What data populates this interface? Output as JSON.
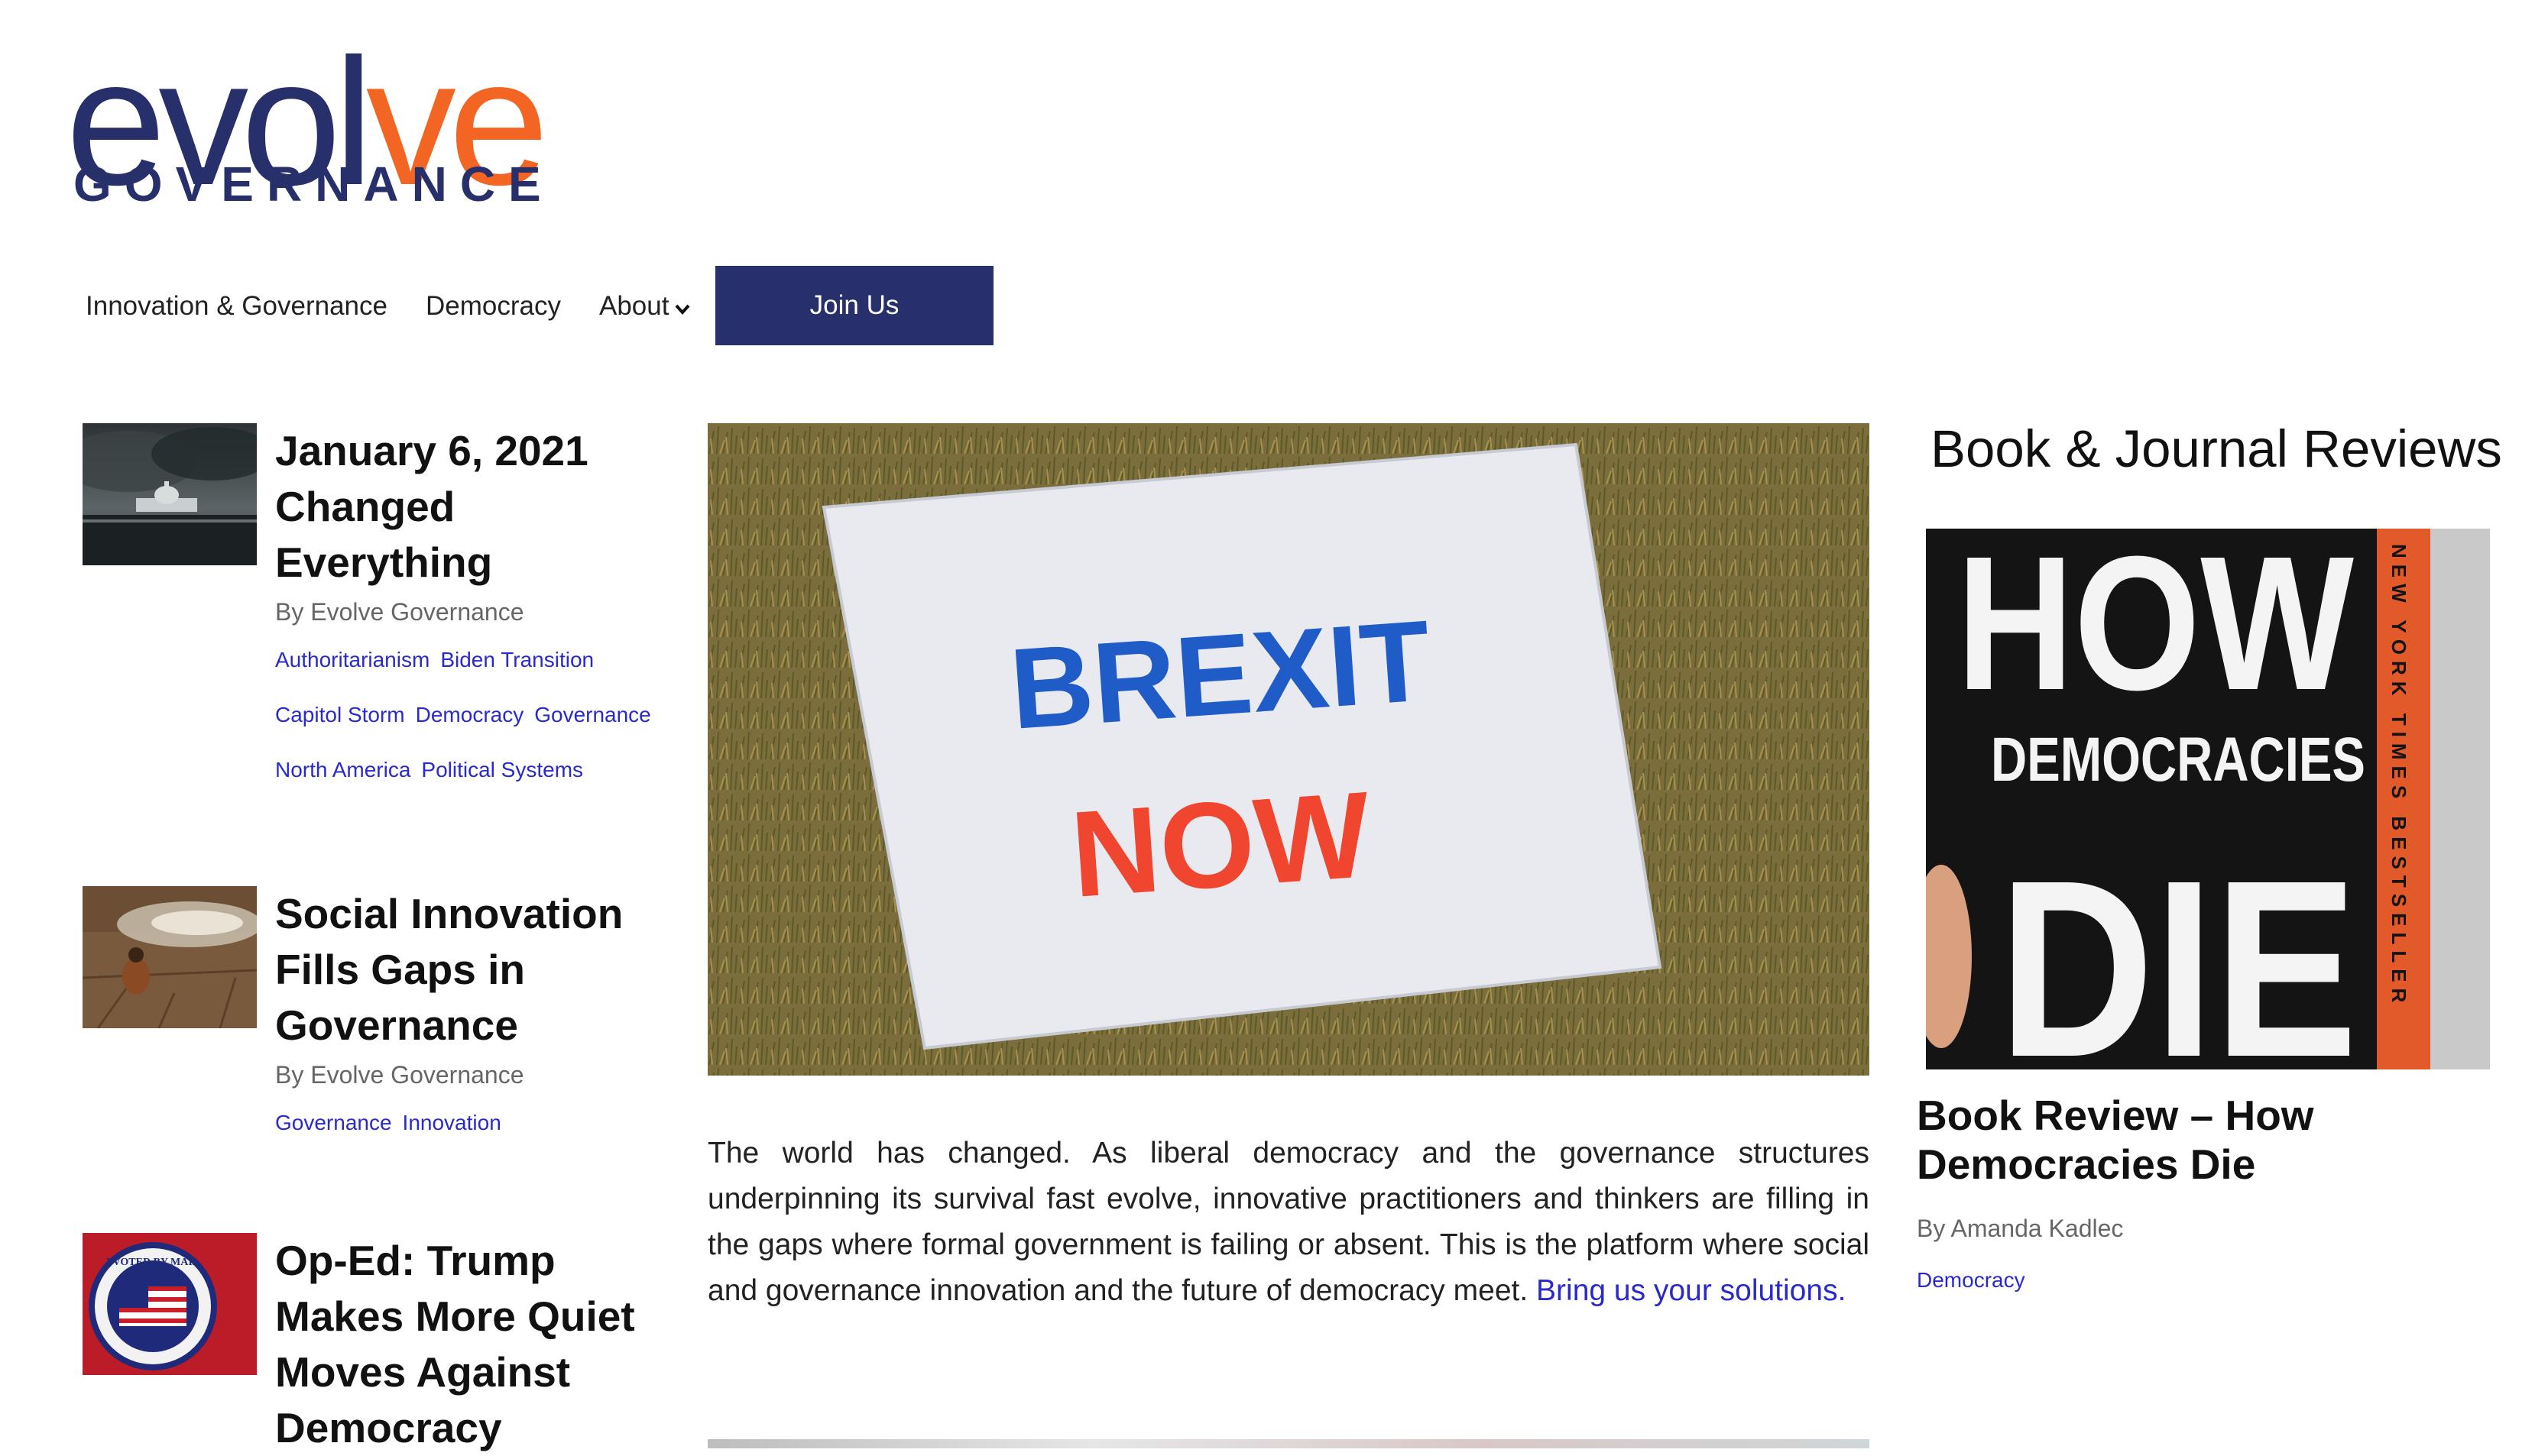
{
  "logo": {
    "word_part1": "evol",
    "word_part2": "ve",
    "subtitle": "GOVERNANCE",
    "accent": "#f26522",
    "brand": "#27306a"
  },
  "nav": {
    "items": [
      "Innovation & Governance",
      "Democracy",
      "About"
    ],
    "join_label": "Join Us"
  },
  "posts": [
    {
      "title": "January 6, 2021 Changed Everything",
      "byline": "By Evolve Governance",
      "tags": [
        "Authoritarianism",
        "Biden Transition",
        "Capitol Storm",
        "Democracy",
        "Governance",
        "North America",
        "Political Systems"
      ]
    },
    {
      "title": "Social Innovation Fills Gaps in Governance",
      "byline": "By Evolve Governance",
      "tags": [
        "Governance",
        "Innovation"
      ]
    },
    {
      "title": "Op-Ed: Trump Makes More Quiet Moves Against Democracy"
    }
  ],
  "hero": {
    "sign_line1": "BREXIT",
    "sign_line2": "NOW"
  },
  "intro": {
    "text": "The world has changed. As liberal democracy and the governance structures underpinning its survival fast evolve, innovative practitioners and thinkers are filling in the gaps where formal government is failing or absent. This is the platform where social and governance innovation and the future of democracy meet. ",
    "link": "Bring us your solutions."
  },
  "reviews": {
    "heading": "Book & Journal Reviews",
    "book_cover": {
      "line1": "HOW",
      "line2": "DEMOCRACIES",
      "line3": "DIE",
      "spine": "NEW YORK TIMES BESTSELLER"
    },
    "title": "Book Review – How Democracies Die",
    "byline": "By Amanda Kadlec",
    "tag": "Democracy"
  },
  "stamp_text": "I VOTED BY MAIL"
}
